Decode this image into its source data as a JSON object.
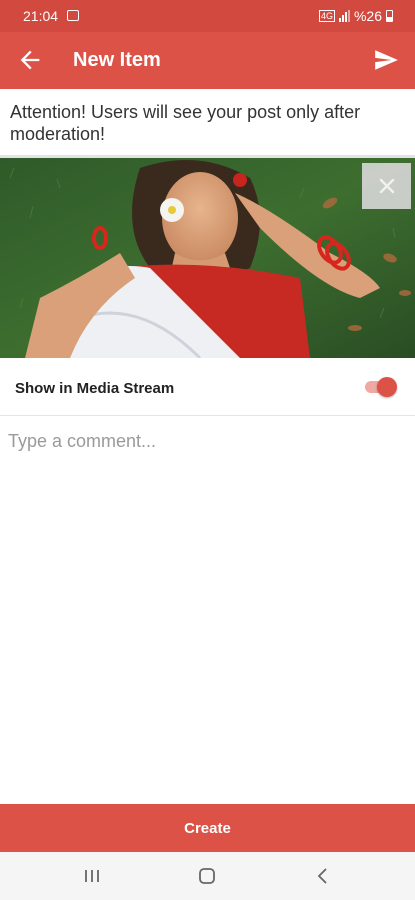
{
  "status_bar": {
    "time": "21:04",
    "signal_text": "%26"
  },
  "app_bar": {
    "title": "New Item",
    "back_icon": "arrow-left-icon",
    "send_icon": "send-icon"
  },
  "notice": {
    "text": "Attention! Users will see your post only after moderation!"
  },
  "photo": {
    "remove_icon": "close-icon"
  },
  "media_stream": {
    "label": "Show in Media Stream",
    "enabled": true
  },
  "comment": {
    "placeholder": "Type a comment..."
  },
  "create_button": {
    "label": "Create"
  },
  "colors": {
    "primary": "#dc5247",
    "status_bar": "#d2493f"
  }
}
